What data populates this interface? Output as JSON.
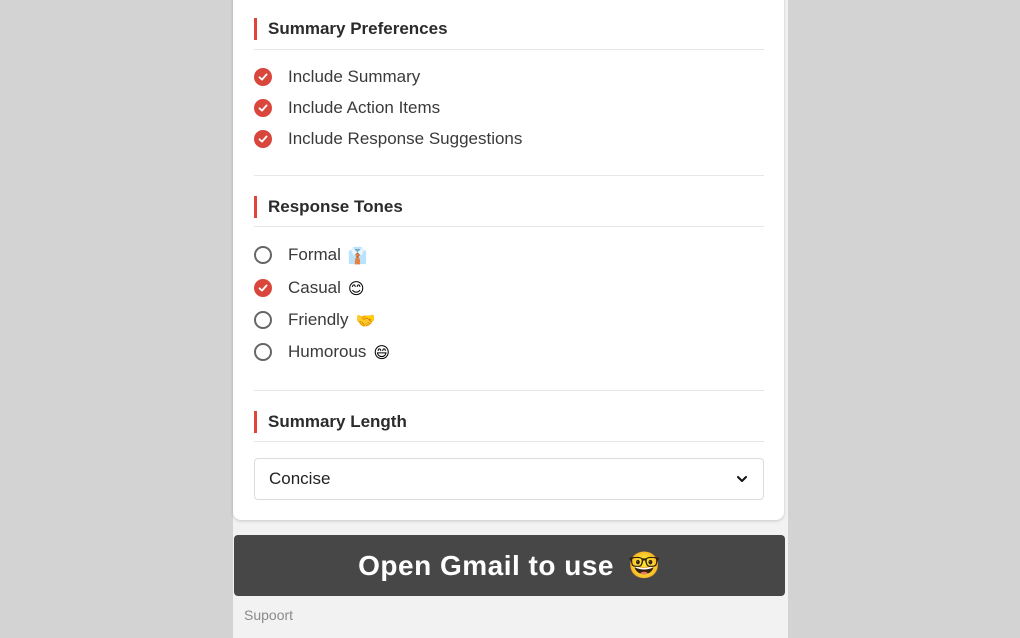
{
  "preferences": {
    "title": "Summary Preferences",
    "options": [
      {
        "label": "Include Summary",
        "checked": true
      },
      {
        "label": "Include Action Items",
        "checked": true
      },
      {
        "label": "Include Response Suggestions",
        "checked": true
      }
    ]
  },
  "tones": {
    "title": "Response Tones",
    "options": [
      {
        "label": "Formal",
        "emoji": "👔",
        "checked": false
      },
      {
        "label": "Casual",
        "emoji": "😊",
        "checked": true
      },
      {
        "label": "Friendly",
        "emoji": "🤝",
        "checked": false
      },
      {
        "label": "Humorous",
        "emoji": "😄",
        "checked": false
      }
    ]
  },
  "length": {
    "title": "Summary Length",
    "selected": "Concise"
  },
  "cta": {
    "label": "Open Gmail to use",
    "emoji": "🤓"
  },
  "support_link": "Supoort",
  "colors": {
    "accent": "#d9463b",
    "button_bg": "#474747",
    "backdrop": "#d3d3d3"
  }
}
